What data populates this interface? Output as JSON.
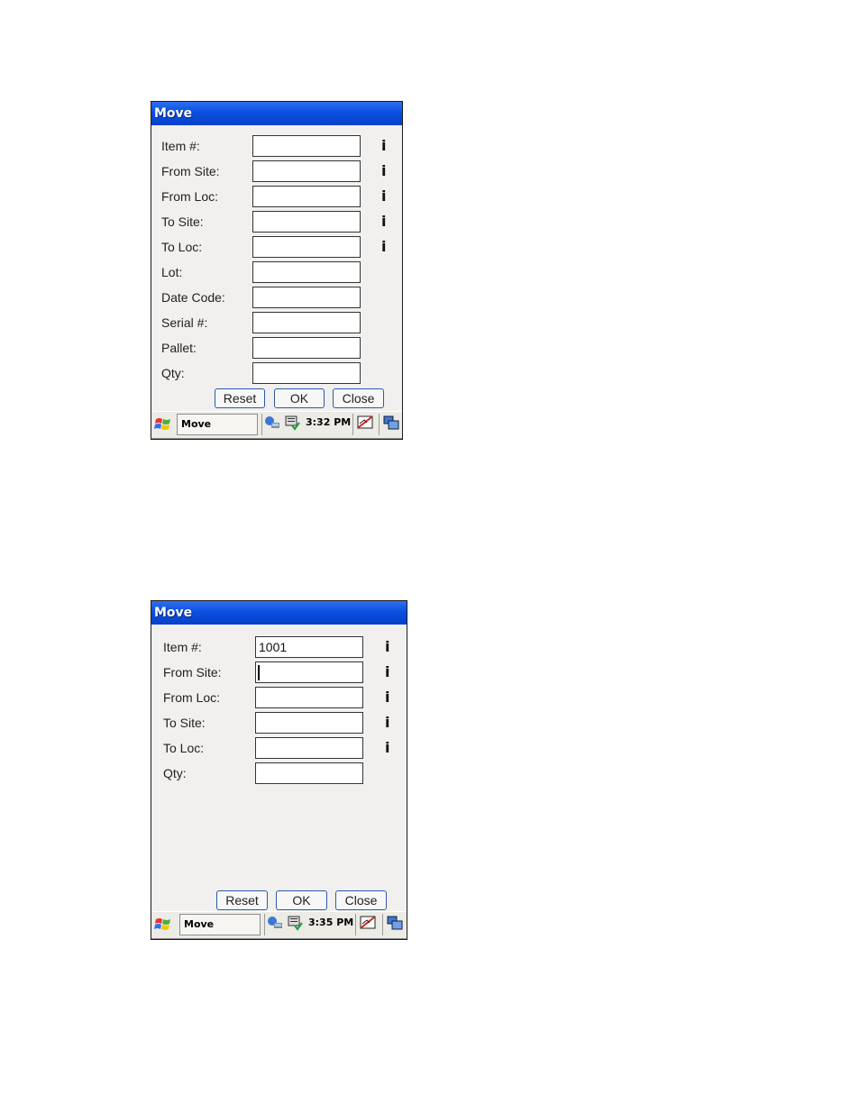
{
  "windows": [
    {
      "title": "Move",
      "fields": [
        {
          "label": "Item #:",
          "value": "",
          "info": true
        },
        {
          "label": "From Site:",
          "value": "",
          "info": true
        },
        {
          "label": "From Loc:",
          "value": "",
          "info": true
        },
        {
          "label": "To Site:",
          "value": "",
          "info": true
        },
        {
          "label": "To Loc:",
          "value": "",
          "info": true
        },
        {
          "label": "Lot:",
          "value": "",
          "info": false
        },
        {
          "label": "Date Code:",
          "value": "",
          "info": false
        },
        {
          "label": "Serial #:",
          "value": "",
          "info": false
        },
        {
          "label": "Pallet:",
          "value": "",
          "info": false
        },
        {
          "label": "Qty:",
          "value": "",
          "info": false
        }
      ],
      "info_glyph": "i",
      "buttons": {
        "reset": "Reset",
        "ok": "OK",
        "close": "Close"
      },
      "taskbar": {
        "task": "Move",
        "clock": "3:32 PM"
      }
    },
    {
      "title": "Move",
      "fields": [
        {
          "label": "Item #:",
          "value": "1001",
          "info": true
        },
        {
          "label": "From Site:",
          "value": "",
          "info": true,
          "focused": true
        },
        {
          "label": "From Loc:",
          "value": "",
          "info": true
        },
        {
          "label": "To Site:",
          "value": "",
          "info": true
        },
        {
          "label": "To Loc:",
          "value": "",
          "info": true
        },
        {
          "label": "Qty:",
          "value": "",
          "info": false
        }
      ],
      "info_glyph": "i",
      "buttons": {
        "reset": "Reset",
        "ok": "OK",
        "close": "Close"
      },
      "taskbar": {
        "task": "Move",
        "clock": "3:35 PM"
      }
    }
  ],
  "icons": {
    "start": "windows-flag-icon",
    "network": "network-icon",
    "keyboard": "input-panel-icon",
    "pen": "pen-input-icon",
    "desktop": "show-desktop-icon"
  },
  "colors": {
    "titlebar": "#0b4fe0",
    "window_bg": "#f1f0ee",
    "button_border": "#2b5aa8"
  }
}
